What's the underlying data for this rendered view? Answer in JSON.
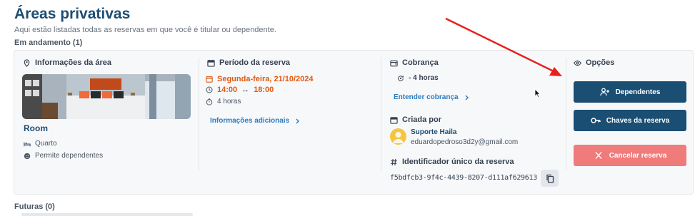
{
  "page": {
    "title": "Áreas privativas",
    "subtitle": "Aqui estão listadas todas as reservas em que você é titular ou dependente.",
    "ongoing_label": "Em andamento (1)",
    "future_label": "Futuras (0)"
  },
  "area": {
    "heading": "Informações da área",
    "room_name": "Room",
    "type": "Quarto",
    "allows_dependents": "Permite dependentes"
  },
  "period": {
    "heading": "Período da reserva",
    "date": "Segunda-feira, 21/10/2024",
    "start": "14:00",
    "end": "18:00",
    "separator": "↔",
    "duration": "4 horas",
    "more_info_link": "Informações adicionais"
  },
  "billing": {
    "heading": "Cobrança",
    "amount": "- 4 horas",
    "understand_link": "Entender cobrança",
    "created_by_heading": "Criada por",
    "creator_name": "Suporte Haila",
    "creator_email": "eduardopedroso3d2y@gmail.com",
    "uid_heading": "Identificador único da reserva",
    "uid": "f5bdfcb3-9f4c-4439-8207-d111af629613"
  },
  "options": {
    "heading": "Opções",
    "dependents_button": "Dependentes",
    "keys_button": "Chaves da reserva",
    "cancel_button": "Cancelar reserva"
  },
  "colors": {
    "primary": "#1b4e73",
    "accent_orange": "#e05a12",
    "link_blue": "#2b7bbf",
    "danger": "#f07b7b",
    "annotation_arrow": "#e8201b"
  },
  "icons": {
    "area": "map-pin-icon",
    "period": "calendar-icon",
    "billing": "wallet-icon",
    "options": "eye-icon"
  }
}
